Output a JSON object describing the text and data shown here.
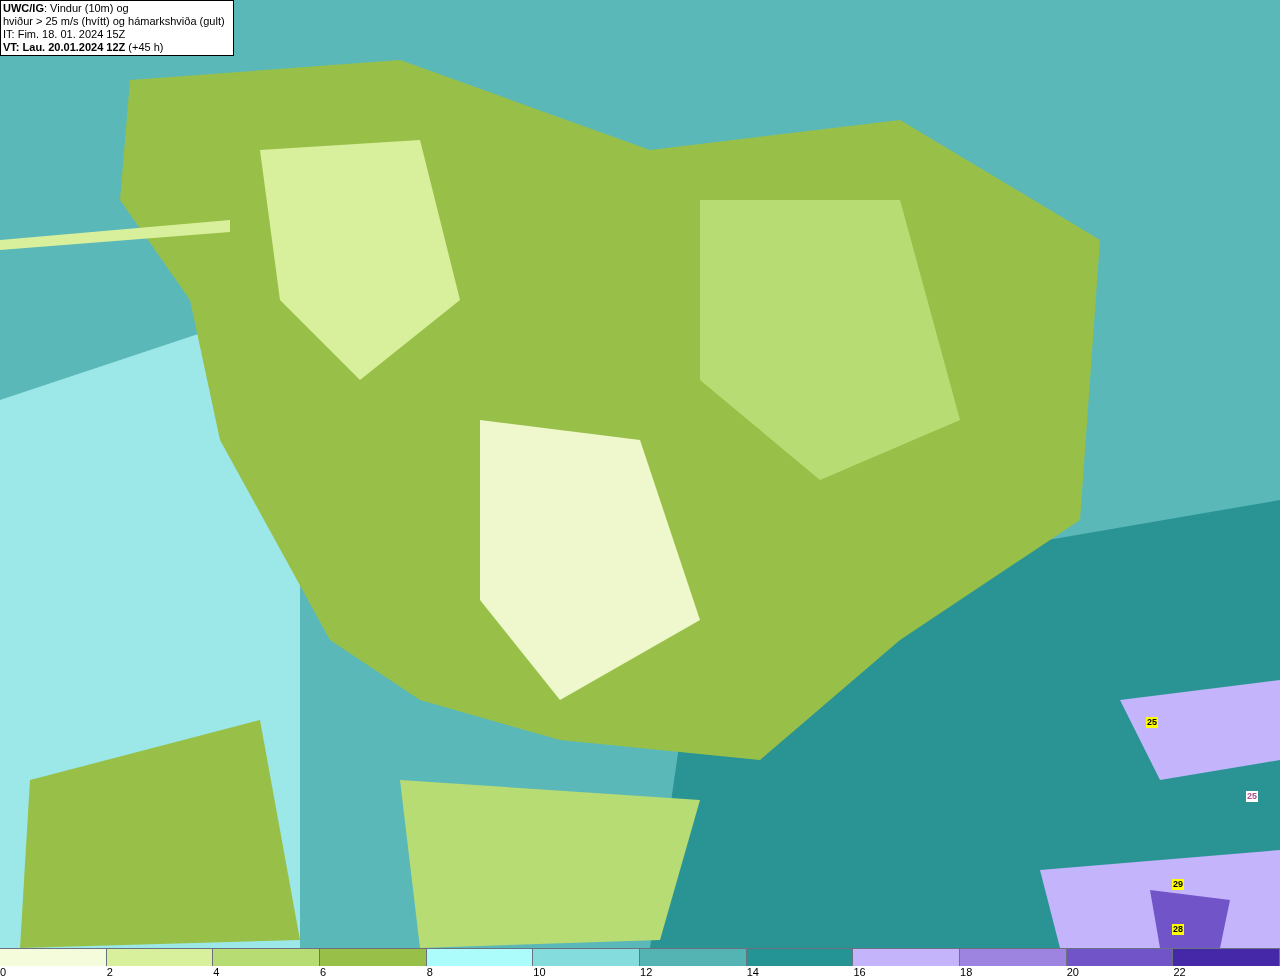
{
  "header": {
    "lines": [
      "**UWC/IG**: Vindur (10m) og",
      "hviður > 25 m/s (hvítt) og hámarkshviða (gult)",
      "IT: Fim. 18. 01. 2024 15Z",
      "**VT: Lau. 20.01.2024 12Z** (+45 h)"
    ]
  },
  "map_labels": [
    {
      "text": "25",
      "color": "#ffff00"
    },
    {
      "text": "25",
      "color": "#ffffff"
    },
    {
      "text": "29",
      "color": "#ffff00"
    },
    {
      "text": "28",
      "color": "#ffff00"
    }
  ],
  "legend": [
    {
      "label": "0",
      "color": "#f4fcdc"
    },
    {
      "label": "2",
      "color": "#d8f09c"
    },
    {
      "label": "4",
      "color": "#b8dc74"
    },
    {
      "label": "6",
      "color": "#98c048"
    },
    {
      "label": "8",
      "color": "#acfcfc"
    },
    {
      "label": "10",
      "color": "#84dcdc"
    },
    {
      "label": "12",
      "color": "#54b4b4"
    },
    {
      "label": "14",
      "color": "#249494"
    },
    {
      "label": "16",
      "color": "#c4b4fc"
    },
    {
      "label": "18",
      "color": "#9c84e0"
    },
    {
      "label": "20",
      "color": "#7054c8"
    },
    {
      "label": "22",
      "color": "#4428a8"
    }
  ]
}
